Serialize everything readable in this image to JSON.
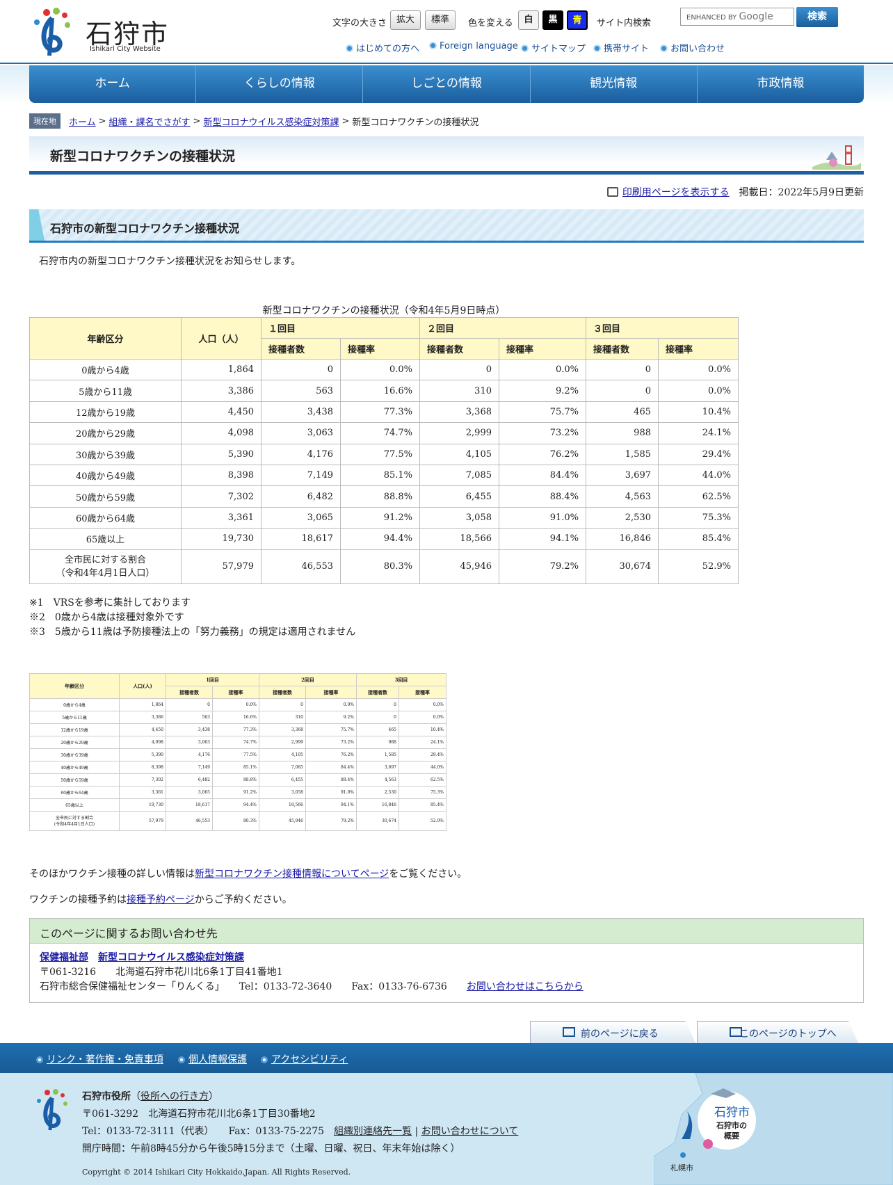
{
  "header": {
    "logo_text": "石狩市",
    "logo_sub": "Ishikari City Website",
    "font_size_label": "文字の大きさ",
    "enlarge_btn": "拡大",
    "standard_btn": "標準",
    "color_label": "色を変える",
    "color_white": "白",
    "color_black": "黒",
    "color_blue": "青",
    "search_label": "サイト内検索",
    "search_placeholder_prefix": "ENHANCED BY",
    "search_placeholder_brand": "Google",
    "search_btn": "検索",
    "sub_links": [
      "はじめての方へ",
      "Foreign language",
      "サイトマップ",
      "携帯サイト",
      "お問い合わせ"
    ]
  },
  "nav": [
    "ホーム",
    "くらしの情報",
    "しごとの情報",
    "観光情報",
    "市政情報"
  ],
  "breadcrumb": {
    "badge": "現在地",
    "items": [
      "ホーム",
      "組織・課名でさがす",
      "新型コロナウイルス感染症対策課"
    ],
    "current": "新型コロナワクチンの接種状況",
    "sep": ">"
  },
  "page_title": "新型コロナワクチンの接種状況",
  "print_link": "印刷用ページを表示する",
  "updated": "掲載日：2022年5月9日更新",
  "section_heading": "石狩市の新型コロナワクチン接種状況",
  "intro": "石狩市内の新型コロナワクチン接種状況をお知らせします。",
  "table": {
    "caption": "新型コロナワクチンの接種状況（令和4年5月9日時点）",
    "col_age": "年齢区分",
    "col_pop": "人口（人）",
    "groups": [
      "１回目",
      "２回目",
      "３回目"
    ],
    "sub_count": "接種者数",
    "sub_rate": "接種率",
    "rows": [
      {
        "label": "0歳から4歳",
        "pop": "1,864",
        "c1": "0",
        "r1": "0.0%",
        "c2": "0",
        "r2": "0.0%",
        "c3": "0",
        "r3": "0.0%"
      },
      {
        "label": "5歳から11歳",
        "pop": "3,386",
        "c1": "563",
        "r1": "16.6%",
        "c2": "310",
        "r2": "9.2%",
        "c3": "0",
        "r3": "0.0%"
      },
      {
        "label": "12歳から19歳",
        "pop": "4,450",
        "c1": "3,438",
        "r1": "77.3%",
        "c2": "3,368",
        "r2": "75.7%",
        "c3": "465",
        "r3": "10.4%"
      },
      {
        "label": "20歳から29歳",
        "pop": "4,098",
        "c1": "3,063",
        "r1": "74.7%",
        "c2": "2,999",
        "r2": "73.2%",
        "c3": "988",
        "r3": "24.1%"
      },
      {
        "label": "30歳から39歳",
        "pop": "5,390",
        "c1": "4,176",
        "r1": "77.5%",
        "c2": "4,105",
        "r2": "76.2%",
        "c3": "1,585",
        "r3": "29.4%"
      },
      {
        "label": "40歳から49歳",
        "pop": "8,398",
        "c1": "7,149",
        "r1": "85.1%",
        "c2": "7,085",
        "r2": "84.4%",
        "c3": "3,697",
        "r3": "44.0%"
      },
      {
        "label": "50歳から59歳",
        "pop": "7,302",
        "c1": "6,482",
        "r1": "88.8%",
        "c2": "6,455",
        "r2": "88.4%",
        "c3": "4,563",
        "r3": "62.5%"
      },
      {
        "label": "60歳から64歳",
        "pop": "3,361",
        "c1": "3,065",
        "r1": "91.2%",
        "c2": "3,058",
        "r2": "91.0%",
        "c3": "2,530",
        "r3": "75.3%"
      },
      {
        "label": "65歳以上",
        "pop": "19,730",
        "c1": "18,617",
        "r1": "94.4%",
        "c2": "18,566",
        "r2": "94.1%",
        "c3": "16,846",
        "r3": "85.4%"
      }
    ],
    "total": {
      "label1": "全市民に対する割合",
      "label2": "（令和4年4月1日人口）",
      "pop": "57,979",
      "c1": "46,553",
      "r1": "80.3%",
      "c2": "45,946",
      "r2": "79.2%",
      "c3": "30,674",
      "r3": "52.9%"
    }
  },
  "notes": [
    "※1　VRSを参考に集計しております",
    "※2　0歳から4歳は接種対象外です",
    "※3　5歳から11歳は予防接種法上の「努力義務」の規定は適用されません"
  ],
  "thumb": {
    "col_age": "年齢区分",
    "col_pop": "人口(人)",
    "groups": [
      "1回目",
      "2回目",
      "3回目"
    ],
    "total_label1": "全市民に対する割合",
    "total_label2": "(令和4年4月1日人口)"
  },
  "para1": {
    "pre": "そのほかワクチン接種の詳しい情報は",
    "link": "新型コロナワクチン接種情報についてページ",
    "post": "をご覧ください。"
  },
  "para2": {
    "pre": "ワクチンの接種予約は",
    "link": "接種予約ページ",
    "post": "からご予約ください。"
  },
  "contact": {
    "heading": "このページに関するお問い合わせ先",
    "dept1": "保健福祉部",
    "dept2": "新型コロナウイルス感染症対策課",
    "address": "〒061-3216　　北海道石狩市花川北6条1丁目41番地1",
    "facility": "石狩市総合保健福祉センター「りんくる」",
    "tel": "Tel：0133-72-3640",
    "fax": "Fax：0133-76-6736",
    "inquiry_link": "お問い合わせはこちらから"
  },
  "page_nav": {
    "back": "前のページに戻る",
    "top": "このページのトップへ"
  },
  "footer": {
    "links": [
      "リンク・著作権・免責事項",
      "個人情報保護",
      "アクセシビリティ"
    ],
    "office": "石狩市役所",
    "directions_link": "役所への行き方",
    "address": "〒061-3292　北海道石狩市花川北6条1丁目30番地2",
    "tel": "Tel：0133-72-3111（代表）",
    "fax": "Fax：0133-75-2275",
    "dir_link": "組織別連絡先一覧",
    "inq_link": "お問い合わせについて",
    "hours": "開庁時間：午前8時45分から午後5時15分まで（土曜、日曜、祝日、年末年始は除く）",
    "copyright": "Copyright © 2014 Ishikari City Hokkaido,Japan. All Rights Reserved.",
    "map_city": "石狩市",
    "map_link": "石狩市の概要",
    "map_sapporo": "札幌市"
  }
}
